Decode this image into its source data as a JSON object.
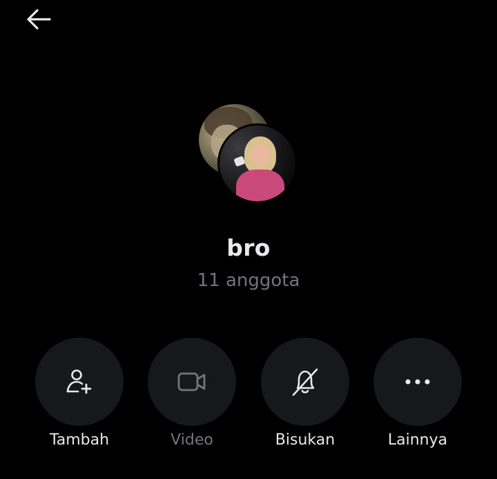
{
  "header": {
    "back_icon": "arrow-left-icon"
  },
  "group": {
    "name": "bro",
    "members": "11 anggota"
  },
  "actions": [
    {
      "label": "Tambah",
      "icon": "add-person-icon",
      "enabled": true
    },
    {
      "label": "Video",
      "icon": "video-camera-icon",
      "enabled": false
    },
    {
      "label": "Bisukan",
      "icon": "bell-off-icon",
      "enabled": true
    },
    {
      "label": "Lainnya",
      "icon": "more-dots-icon",
      "enabled": true
    }
  ],
  "colors": {
    "background": "#000000",
    "button_bg": "#16181c",
    "text_primary": "#e7e9ea",
    "text_secondary": "#71767b"
  }
}
